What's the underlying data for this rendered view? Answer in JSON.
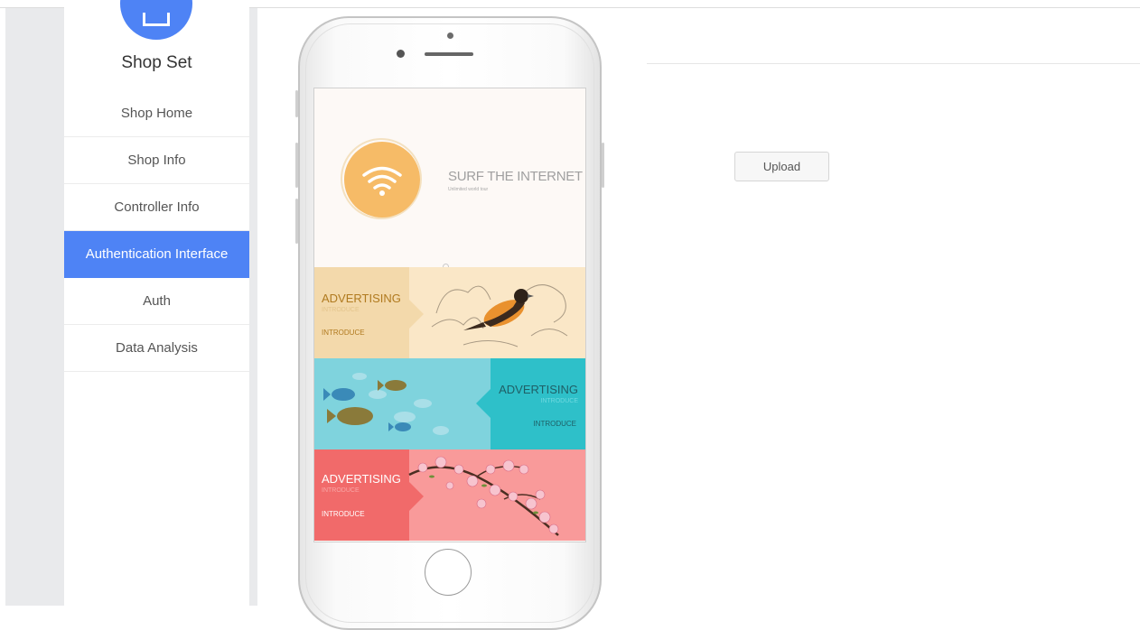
{
  "sidebar": {
    "title": "Shop Set",
    "items": [
      {
        "label": "Shop Home"
      },
      {
        "label": "Shop Info"
      },
      {
        "label": "Controller Info"
      },
      {
        "label": "Authentication Interface",
        "active": true
      },
      {
        "label": "Auth"
      },
      {
        "label": "Data Analysis"
      }
    ],
    "accent_color": "#4e83f5"
  },
  "preview": {
    "banner": {
      "headline": "SURF THE INTERNET",
      "subline": "Unlimited world tour",
      "icon": "wifi-icon"
    },
    "ads": [
      {
        "title": "ADVERTISING",
        "subtitle": "INTRODUCE",
        "label": "INTRODUCE",
        "theme": "#f3d9ab",
        "image": "bird-illustration"
      },
      {
        "title": "ADVERTISING",
        "subtitle": "INTRODUCE",
        "label": "INTRODUCE",
        "theme": "#2ec0c9",
        "image": "fish-illustration"
      },
      {
        "title": "ADVERTISING",
        "subtitle": "INTRODUCE",
        "label": "INTRODUCE",
        "theme": "#f16a6a",
        "image": "cherry-blossom-illustration"
      }
    ]
  },
  "upload": {
    "label": "Upload"
  }
}
